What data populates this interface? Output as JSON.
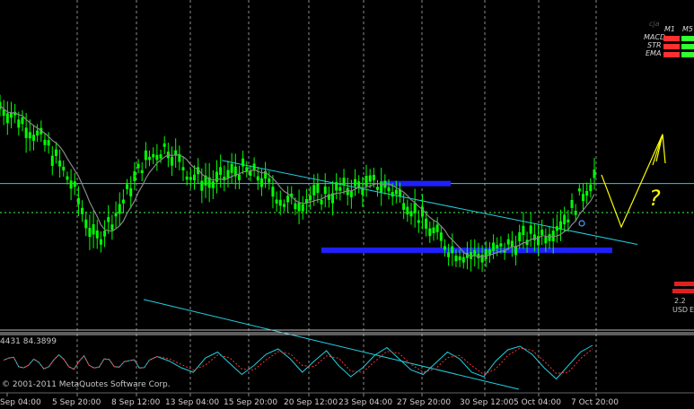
{
  "watermark": "© 2001-2011 MetaQuotes Software Corp.",
  "subwindow_readout": "4431 84.3899",
  "indicator_panel": {
    "header": "cja",
    "timeframes": [
      "M1",
      "M5"
    ],
    "rows": [
      {
        "label": "MACD",
        "colors": [
          "#ff3030",
          "#30ff30"
        ]
      },
      {
        "label": "STR",
        "colors": [
          "#ff3030",
          "#30ff30"
        ]
      },
      {
        "label": "EMA",
        "colors": [
          "#ff3030",
          "#30ff30"
        ]
      }
    ]
  },
  "side_panel": {
    "values": [
      "2.2",
      "USD",
      "E"
    ]
  },
  "annotation": {
    "text": "?",
    "color": "#ffff00"
  },
  "colors": {
    "background": "#000000",
    "candle": "#00ff00",
    "ma_line": "#888888",
    "channel": "#20d0e0",
    "level_zone": "#2020ff",
    "grid": "#8a8a8a",
    "stoch_main": "#1fd0e0",
    "stoch_signal": "#ff3030"
  },
  "chart_data": {
    "type": "candlestick",
    "title": "",
    "x_tick_labels": [
      "Sep 04:00",
      "5 Sep 20:00",
      "8 Sep 12:00",
      "13 Sep 04:00",
      "15 Sep 20:00",
      "20 Sep 12:00",
      "23 Sep 04:00",
      "27 Sep 20:00",
      "30 Sep 12:00",
      "5 Oct 04:00",
      "7 Oct 20:00"
    ],
    "price": [
      0.72,
      0.66,
      0.58,
      0.45,
      0.25,
      0.36,
      0.52,
      0.58,
      0.48,
      0.45,
      0.5,
      0.47,
      0.38,
      0.4,
      0.42,
      0.44,
      0.45,
      0.4,
      0.3,
      0.22,
      0.2,
      0.22,
      0.26,
      0.28,
      0.35,
      0.48
    ],
    "channel_upper": [
      0.53,
      0.24
    ],
    "channel_lower": [
      0.05,
      -0.26
    ],
    "horizontal_lines": [
      0.45,
      0.35
    ],
    "resistance_zone": 0.45,
    "support_zone": 0.22,
    "projection": [
      0.48,
      0.3,
      0.62
    ],
    "oscillator": [
      65,
      55,
      40,
      30,
      62,
      75,
      50,
      25,
      45,
      70,
      82,
      60,
      30,
      55,
      78,
      45,
      20,
      40,
      68,
      85,
      60,
      35,
      25,
      50,
      75,
      60,
      30,
      20,
      55,
      80,
      88,
      70,
      40,
      15,
      45,
      75,
      90
    ],
    "oscillator_ylim": [
      0,
      100
    ]
  }
}
